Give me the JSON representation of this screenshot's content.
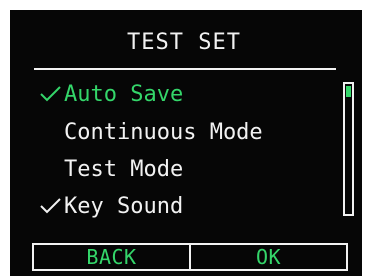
{
  "screen": {
    "title": "TEST SET"
  },
  "menu": {
    "items": [
      {
        "label": "Auto Save",
        "checked": true,
        "selected": true
      },
      {
        "label": "Continuous Mode",
        "checked": false,
        "selected": false
      },
      {
        "label": "Test Mode",
        "checked": false,
        "selected": false
      },
      {
        "label": "Key Sound",
        "checked": true,
        "selected": false
      }
    ]
  },
  "scrollbar": {
    "position": 0
  },
  "softkeys": {
    "back_label": "BACK",
    "ok_label": "OK"
  },
  "colors": {
    "background": "#060606",
    "text": "#f2f2f2",
    "accent": "#34d66a"
  }
}
